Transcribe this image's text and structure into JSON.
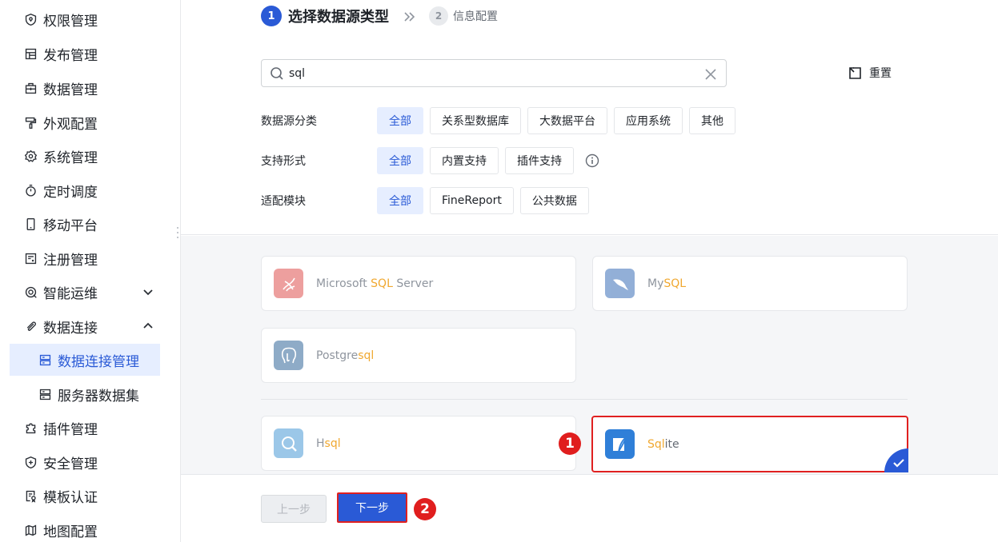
{
  "sidebar": {
    "items": [
      {
        "label": "权限管理",
        "icon": "shield-icon"
      },
      {
        "label": "发布管理",
        "icon": "publish-icon"
      },
      {
        "label": "数据管理",
        "icon": "briefcase-icon"
      },
      {
        "label": "外观配置",
        "icon": "paint-roller-icon"
      },
      {
        "label": "系统管理",
        "icon": "gear-icon"
      },
      {
        "label": "定时调度",
        "icon": "timer-icon"
      },
      {
        "label": "移动平台",
        "icon": "mobile-icon"
      },
      {
        "label": "注册管理",
        "icon": "register-icon"
      },
      {
        "label": "智能运维",
        "icon": "ops-icon"
      },
      {
        "label": "数据连接",
        "icon": "paperclip-icon"
      },
      {
        "label": "数据连接管理",
        "icon": "server-icon"
      },
      {
        "label": "服务器数据集",
        "icon": "server-icon"
      },
      {
        "label": "插件管理",
        "icon": "puzzle-icon"
      },
      {
        "label": "安全管理",
        "icon": "shield-plus-icon"
      },
      {
        "label": "模板认证",
        "icon": "certificate-icon"
      },
      {
        "label": "地图配置",
        "icon": "map-icon"
      }
    ]
  },
  "steps": {
    "step1_num": "1",
    "step1_label": "选择数据源类型",
    "step2_num": "2",
    "step2_label": "信息配置"
  },
  "search": {
    "value": "sql"
  },
  "reset_label": "重置",
  "filters": {
    "category": {
      "label": "数据源分类",
      "options": [
        "全部",
        "关系型数据库",
        "大数据平台",
        "应用系统",
        "其他"
      ]
    },
    "support": {
      "label": "支持形式",
      "options": [
        "全部",
        "内置支持",
        "插件支持"
      ]
    },
    "module": {
      "label": "适配模块",
      "options": [
        "全部",
        "FineReport",
        "公共数据"
      ]
    }
  },
  "datasources": [
    {
      "pre": "Microsoft ",
      "hl": "SQL",
      "post": " Server",
      "logo_color": "#e0524f"
    },
    {
      "pre": "My",
      "hl": "SQL",
      "post": "",
      "logo_color": "#3a6fb8"
    },
    {
      "pre": "Postgre",
      "hl": "sql",
      "post": "",
      "logo_color": "#33689a"
    },
    {
      "pre": "H",
      "hl": "sql",
      "post": "",
      "logo_color": "#4a9bd6"
    },
    {
      "pre": "",
      "hl": "Sql",
      "post": "ite",
      "logo_color": "#2f7fd8"
    }
  ],
  "badges": {
    "one": "1",
    "two": "2"
  },
  "footer": {
    "prev_label": "上一步",
    "next_label": "下一步"
  },
  "colors": {
    "accent": "#2a5ad6",
    "highlight": "#f0a830",
    "annotation_red": "#e01e1e"
  }
}
